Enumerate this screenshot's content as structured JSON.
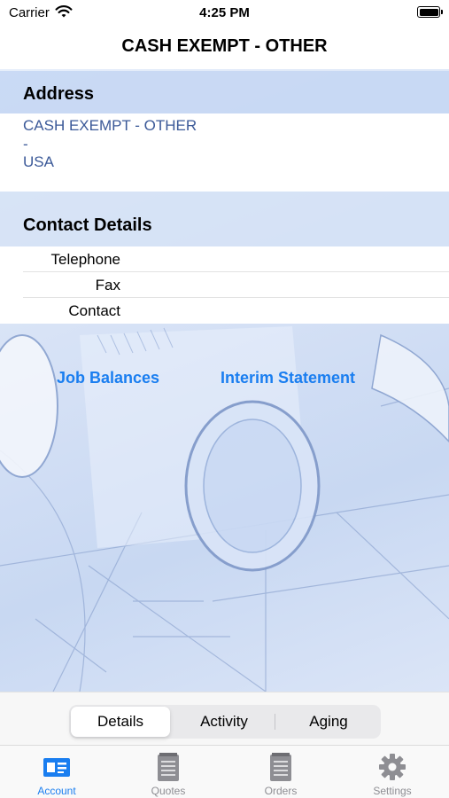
{
  "status_bar": {
    "carrier": "Carrier",
    "time": "4:25 PM"
  },
  "nav": {
    "title": "CASH EXEMPT - OTHER"
  },
  "address": {
    "header": "Address",
    "lines": [
      "CASH EXEMPT - OTHER",
      "-",
      "USA"
    ]
  },
  "contact": {
    "header": "Contact Details",
    "rows": [
      {
        "label": "Telephone",
        "value": ""
      },
      {
        "label": "Fax",
        "value": ""
      },
      {
        "label": "Contact",
        "value": ""
      }
    ]
  },
  "links": {
    "job_balances": "Job Balances",
    "interim_statement": "Interim Statement"
  },
  "segments": {
    "items": [
      "Details",
      "Activity",
      "Aging"
    ],
    "selected": "Details"
  },
  "tabs": [
    {
      "label": "Account",
      "icon": "account-card-icon",
      "active": true
    },
    {
      "label": "Quotes",
      "icon": "notepad-icon",
      "active": false
    },
    {
      "label": "Orders",
      "icon": "notepad-icon",
      "active": false
    },
    {
      "label": "Settings",
      "icon": "gear-icon",
      "active": false
    }
  ],
  "colors": {
    "accent": "#1a7ef0",
    "address_text": "#3b5998",
    "section_bg": "#c4d6f3"
  }
}
